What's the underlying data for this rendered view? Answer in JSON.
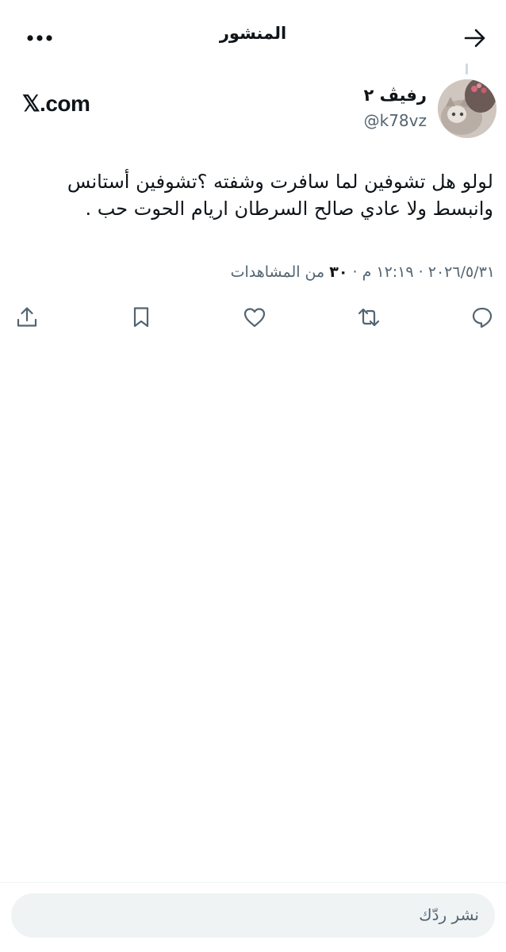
{
  "header": {
    "title": "المنشور"
  },
  "post": {
    "author_name": "رفيڤ ٢",
    "author_handle": "@k78vz",
    "source": "𝕏.com",
    "text": "لولو هل تشوفين لما سافرت وشفته ؟تشوفين أستانس وانبسط ولا عادي صالح السرطان اريام الحوت حب .",
    "date": "٢٠٢٦/٥/٣١",
    "time": "١٢:١٩ م",
    "separator": " · ",
    "views_count": "٣٠",
    "views_label": "من المشاهدات"
  },
  "actions": [
    "reply-icon",
    "repost-icon",
    "like-icon",
    "bookmark-icon",
    "share-icon"
  ],
  "composer": {
    "placeholder": "نشر ردّك"
  },
  "colors": {
    "text": "#0f1419",
    "secondary": "#536471",
    "input_bg": "#eff3f4"
  }
}
